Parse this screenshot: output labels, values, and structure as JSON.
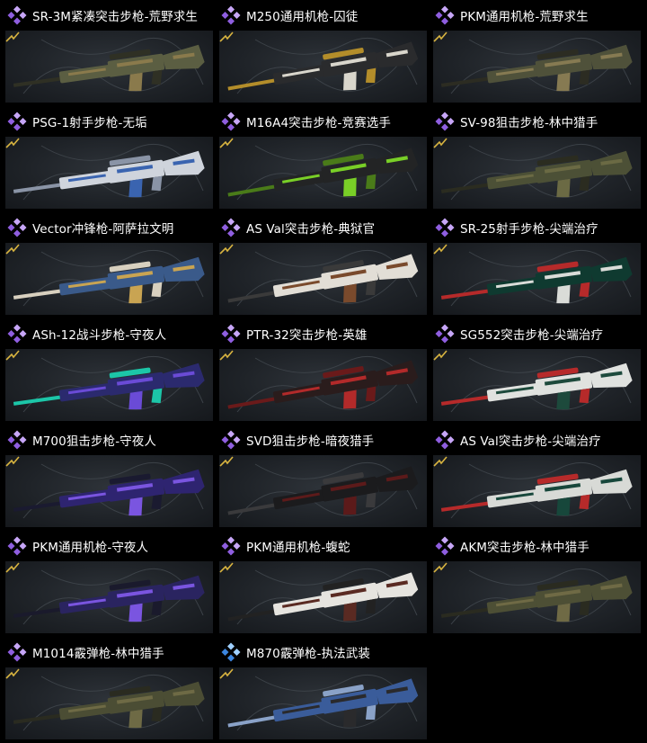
{
  "items": [
    {
      "title": "SR-3M紧凑突击步枪-荒野求生",
      "rarity": "purple",
      "body": "#5b5e42",
      "accent": "#8a7a4c",
      "detail": "#2f3024"
    },
    {
      "title": "M250通用机枪-囚徒",
      "rarity": "purple",
      "body": "#2a2b2d",
      "accent": "#d9d6cc",
      "detail": "#b38d2a"
    },
    {
      "title": "PKM通用机枪-荒野求生",
      "rarity": "purple",
      "body": "#4f513a",
      "accent": "#867a52",
      "detail": "#2c2c22"
    },
    {
      "title": "PSG-1射手步枪-无垢",
      "rarity": "purple",
      "body": "#cfd4dc",
      "accent": "#3a64b0",
      "detail": "#8a94a6"
    },
    {
      "title": "M16A4突击步枪-竞赛选手",
      "rarity": "purple",
      "body": "#232425",
      "accent": "#79cf27",
      "detail": "#4a7b19"
    },
    {
      "title": "SV-98狙击步枪-林中猎手",
      "rarity": "purple",
      "body": "#4c5036",
      "accent": "#6b6a44",
      "detail": "#2b2c20"
    },
    {
      "title": "Vector冲锋枪-阿萨拉文明",
      "rarity": "purple",
      "body": "#3a5a8a",
      "accent": "#c9a452",
      "detail": "#d8d0bf"
    },
    {
      "title": "AS Val突击步枪-典狱官",
      "rarity": "purple",
      "body": "#e2ded6",
      "accent": "#7a4a2c",
      "detail": "#3a3a3a"
    },
    {
      "title": "SR-25射手步枪-尖端治疗",
      "rarity": "purple",
      "body": "#0f3a30",
      "accent": "#dadcd8",
      "detail": "#b62a2a"
    },
    {
      "title": "ASh-12战斗步枪-守夜人",
      "rarity": "purple",
      "body": "#2b2a6e",
      "accent": "#6a4bd6",
      "detail": "#1cc6a8"
    },
    {
      "title": "PTR-32突击步枪-英雄",
      "rarity": "purple",
      "body": "#2a1c1c",
      "accent": "#b22a2a",
      "detail": "#6a1a1a"
    },
    {
      "title": "SG552突击步枪-尖端治疗",
      "rarity": "purple",
      "body": "#e0e2df",
      "accent": "#1d4a3c",
      "detail": "#b62a2a"
    },
    {
      "title": "M700狙击步枪-守夜人",
      "rarity": "purple",
      "body": "#2e2470",
      "accent": "#7a55e0",
      "detail": "#1a1a30"
    },
    {
      "title": "SVD狙击步枪-暗夜猎手",
      "rarity": "purple",
      "body": "#1b1b1d",
      "accent": "#5c1a1a",
      "detail": "#3a3a3c"
    },
    {
      "title": "AS Val突击步枪-尖端治疗",
      "rarity": "purple",
      "body": "#d8dad6",
      "accent": "#17473b",
      "detail": "#b62a2a"
    },
    {
      "title": "PKM通用机枪-守夜人",
      "rarity": "purple",
      "body": "#2a2460",
      "accent": "#7a55e0",
      "detail": "#1a1a2c"
    },
    {
      "title": "PKM通用机枪-蝮蛇",
      "rarity": "purple",
      "body": "#e6e4df",
      "accent": "#5a2a22",
      "detail": "#222222"
    },
    {
      "title": "AKM突击步枪-林中猎手",
      "rarity": "purple",
      "body": "#4d4f35",
      "accent": "#6f6a45",
      "detail": "#2a2b20"
    },
    {
      "title": "M1014霰弹枪-林中猎手",
      "rarity": "purple",
      "body": "#4b4d34",
      "accent": "#6e6a45",
      "detail": "#2a2b20"
    },
    {
      "title": "M870霰弹枪-执法武装",
      "rarity": "blue",
      "body": "#3a5c9a",
      "accent": "#2a2a2c",
      "detail": "#8aa2c8"
    }
  ],
  "colors": {
    "purple_light": "#c7a6f7",
    "purple_dark": "#8f5ee0",
    "blue_light": "#9fd0ff",
    "blue_dark": "#3c86e0",
    "corner_mark": "#d8b440"
  }
}
